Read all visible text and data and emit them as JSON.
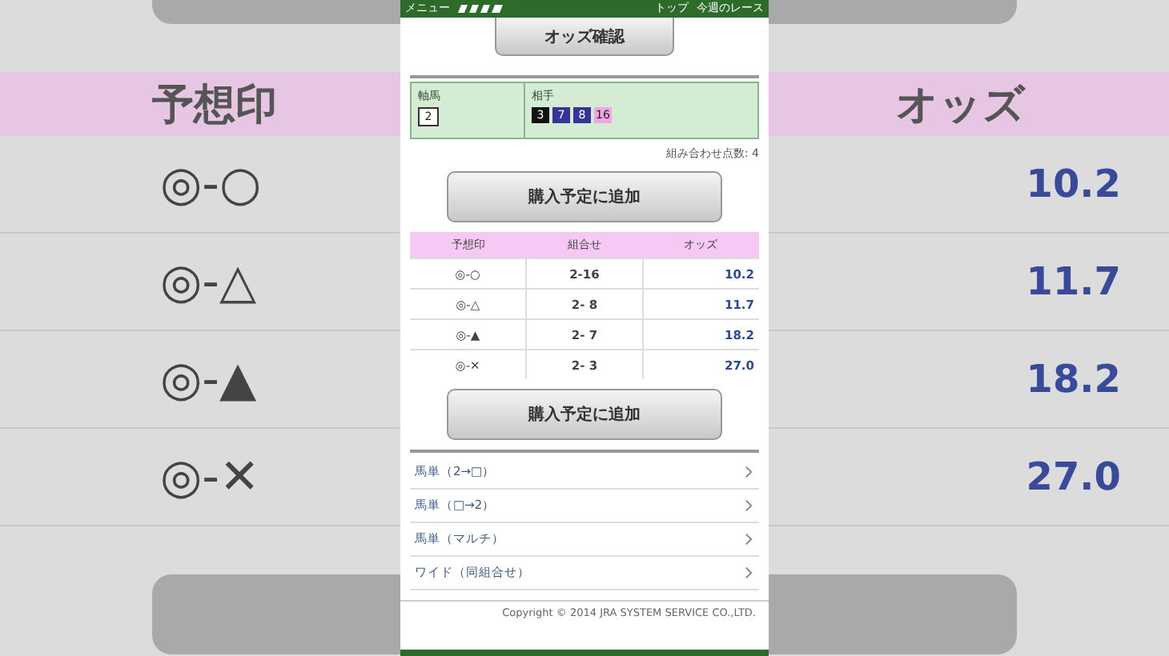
{
  "backdrop": {
    "mark_header": "予想印",
    "odds_header": "オッズ",
    "rows": [
      {
        "mark": "◎-○",
        "odds": "10.2"
      },
      {
        "mark": "◎-△",
        "odds": "11.7"
      },
      {
        "mark": "◎-▲",
        "odds": "18.2"
      },
      {
        "mark": "◎-✕",
        "odds": "27.0"
      }
    ]
  },
  "header": {
    "menu": "メニュー",
    "links": [
      "トップ",
      "今週のレース"
    ]
  },
  "odds_button": "オッズ確認",
  "selection": {
    "axis_label": "軸馬",
    "axis": {
      "number": "2",
      "color": "#ffffff"
    },
    "partner_label": "相手",
    "partners": [
      {
        "number": "3",
        "color": "#111111"
      },
      {
        "number": "7",
        "color": "#34349a"
      },
      {
        "number": "8",
        "color": "#34349a"
      },
      {
        "number": "16",
        "color": "#f0a6e6"
      }
    ]
  },
  "combo_count": "組み合わせ点数: 4",
  "add_button_top": "購入予定に追加",
  "table": {
    "columns": [
      "予想印",
      "組合せ",
      "オッズ"
    ],
    "rows": [
      {
        "mark": "◎-○",
        "combo": "2-16",
        "odds": "10.2"
      },
      {
        "mark": "◎-△",
        "combo": "2- 8",
        "odds": "11.7"
      },
      {
        "mark": "◎-▲",
        "combo": "2- 7",
        "odds": "18.2"
      },
      {
        "mark": "◎-✕",
        "combo": "2- 3",
        "odds": "27.0"
      }
    ]
  },
  "add_button_bottom": "購入予定に追加",
  "links": [
    "馬単（2→□）",
    "馬単（□→2）",
    "馬単（マルチ）",
    "ワイド（同組合せ）"
  ],
  "copyright": "Copyright © 2014 JRA SYSTEM SERVICE CO.,LTD."
}
